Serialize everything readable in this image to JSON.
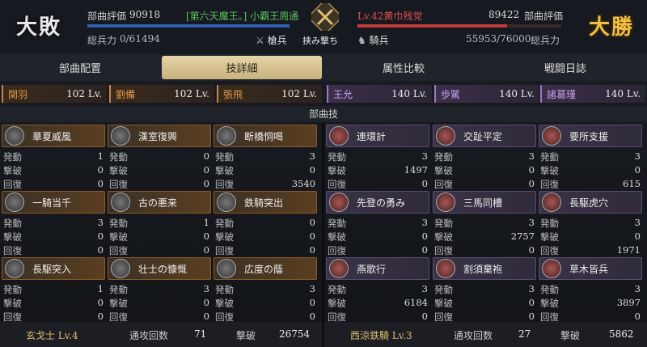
{
  "left": {
    "result": "大敗",
    "eval_label": "部曲評価",
    "eval_value": "90918",
    "player": "[第六天魔王。] 小覇王周通",
    "troops_label": "総兵力",
    "troops": "0/61494",
    "unit_type": "槍兵",
    "bar_color": "#2f5fb0"
  },
  "center": {
    "label": "挟み撃ち",
    "icon": "crossed-swords-icon"
  },
  "right": {
    "result": "大勝",
    "enemy": "Lv.42黄巾残党",
    "eval_value": "89422",
    "eval_label": "部曲評価",
    "unit_type": "騎兵",
    "troops": "55953/76000",
    "troops_label": "総兵力",
    "troops_frac": 0.736,
    "bar_color": "#c23a3a"
  },
  "tabs": [
    {
      "label": "部曲配置",
      "active": false
    },
    {
      "label": "技詳細",
      "active": true
    },
    {
      "label": "属性比較",
      "active": false
    },
    {
      "label": "戦闘日誌",
      "active": false
    }
  ],
  "left_generals": [
    {
      "name": "関羽",
      "lv": "102 Lv."
    },
    {
      "name": "劉備",
      "lv": "102 Lv."
    },
    {
      "name": "張飛",
      "lv": "102 Lv."
    }
  ],
  "right_generals": [
    {
      "name": "王允",
      "lv": "140 Lv."
    },
    {
      "name": "歩騭",
      "lv": "140 Lv."
    },
    {
      "name": "諸葛瑾",
      "lv": "140 Lv."
    }
  ],
  "section_title": "部曲技",
  "stat_labels": {
    "activate": "発動",
    "kill": "撃破",
    "heal": "回復"
  },
  "left_skills": [
    {
      "name": "華夏威風",
      "activate": "1",
      "kill": "0",
      "heal": "0"
    },
    {
      "name": "漢室復興",
      "activate": "0",
      "kill": "0",
      "heal": "0"
    },
    {
      "name": "断橋恫喝",
      "activate": "3",
      "kill": "0",
      "heal": "3540"
    },
    {
      "name": "一騎当千",
      "activate": "3",
      "kill": "0",
      "heal": "0"
    },
    {
      "name": "古の悪来",
      "activate": "1",
      "kill": "0",
      "heal": "0"
    },
    {
      "name": "鉄騎突出",
      "activate": "0",
      "kill": "0",
      "heal": "0"
    },
    {
      "name": "長駆突入",
      "activate": "1",
      "kill": "0",
      "heal": "0"
    },
    {
      "name": "壮士の慷慨",
      "activate": "3",
      "kill": "0",
      "heal": "0"
    },
    {
      "name": "広度の蔭",
      "activate": "3",
      "kill": "0",
      "heal": "0"
    }
  ],
  "right_skills": [
    {
      "name": "連環計",
      "activate": "3",
      "kill": "1497",
      "heal": "0"
    },
    {
      "name": "交趾平定",
      "activate": "3",
      "kill": "0",
      "heal": "0"
    },
    {
      "name": "要所支援",
      "activate": "3",
      "kill": "0",
      "heal": "615"
    },
    {
      "name": "先登の勇み",
      "activate": "3",
      "kill": "0",
      "heal": "0"
    },
    {
      "name": "三馬同槽",
      "activate": "3",
      "kill": "2757",
      "heal": "0"
    },
    {
      "name": "長駆虎穴",
      "activate": "3",
      "kill": "0",
      "heal": "1971"
    },
    {
      "name": "燕歌行",
      "activate": "3",
      "kill": "6184",
      "heal": "0"
    },
    {
      "name": "割須棄袍",
      "activate": "3",
      "kill": "0",
      "heal": "0"
    },
    {
      "name": "草木皆兵",
      "activate": "3",
      "kill": "3897",
      "heal": "0"
    }
  ],
  "left_footer": {
    "unit": "玄戈士 Lv.4",
    "attacks_label": "通攻回数",
    "attacks": "71",
    "kills_label": "撃破",
    "kills": "26754"
  },
  "right_footer": {
    "unit": "西涼鉄騎 Lv.3",
    "attacks_label": "通攻回数",
    "attacks": "27",
    "kills_label": "撃破",
    "kills": "5862"
  }
}
